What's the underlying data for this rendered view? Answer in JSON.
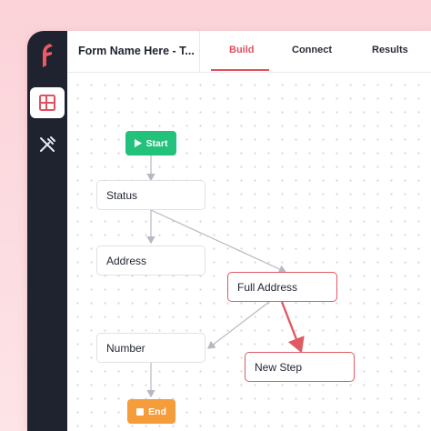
{
  "header": {
    "form_title": "Form Name Here - T...",
    "tabs": [
      {
        "label": "Build",
        "active": true
      },
      {
        "label": "Connect",
        "active": false
      },
      {
        "label": "Results",
        "active": false
      }
    ]
  },
  "rail": {
    "items": [
      {
        "icon": "layout-icon",
        "active": true
      },
      {
        "icon": "tools-icon",
        "active": false
      }
    ]
  },
  "flow": {
    "start_label": "Start",
    "end_label": "End",
    "nodes": {
      "status": "Status",
      "address": "Address",
      "full_address": "Full Address",
      "number": "Number",
      "new_step": "New Step"
    }
  },
  "colors": {
    "accent": "#e0505e",
    "start": "#22c27a",
    "end": "#f59c3b",
    "rail": "#1f2330"
  }
}
